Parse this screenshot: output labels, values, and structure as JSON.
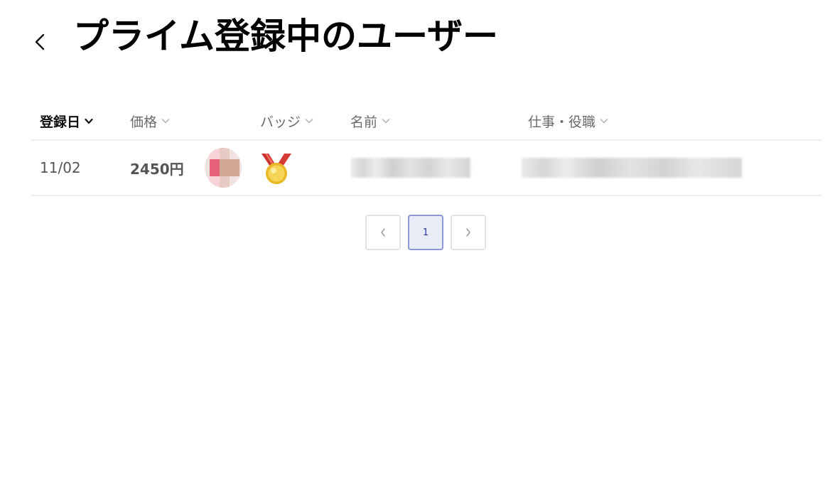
{
  "header": {
    "title": "プライム登録中のユーザー",
    "back_icon": "chevron-left-icon"
  },
  "table": {
    "columns": [
      {
        "label": "登録日",
        "sorted": true
      },
      {
        "label": "価格",
        "sorted": false
      },
      {
        "label": "バッジ",
        "sorted": false
      },
      {
        "label": "名前",
        "sorted": false
      },
      {
        "label": "仕事・役職",
        "sorted": false
      }
    ],
    "rows": [
      {
        "date": "11/02",
        "price": "2450円",
        "avatar_icon": "avatar-image",
        "badge_icon": "gold-medal-icon"
      }
    ]
  },
  "pagination": {
    "prev_icon": "chevron-left-icon",
    "current_page": "1",
    "next_icon": "chevron-right-icon"
  },
  "colors": {
    "active_page_bg": "#e9ebf6",
    "active_page_border": "#8f96d6",
    "active_page_text": "#2c3aa8"
  }
}
